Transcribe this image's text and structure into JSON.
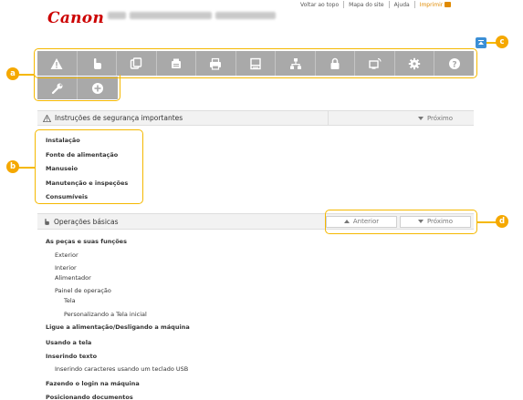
{
  "header": {
    "logo": "Canon",
    "nav": [
      {
        "label": "Voltar ao topo"
      },
      {
        "label": "Mapa do site"
      },
      {
        "label": "Ajuda"
      },
      {
        "label": "Imprimir"
      }
    ]
  },
  "toolbar": {
    "icons": [
      "warning-icon",
      "hand-icon",
      "document-copy-icon",
      "fax-icon",
      "printer-icon",
      "scanner-icon",
      "network-icon",
      "lock-icon",
      "remote-ui-icon",
      "gear-icon",
      "help-icon",
      "wrench-icon",
      "plus-circle-icon"
    ]
  },
  "safety": {
    "title": "Instruções de segurança importantes",
    "next": "Próximo",
    "links": [
      "Instalação",
      "Fonte de alimentação",
      "Manuseio",
      "Manutenção e inspeções",
      "Consumíveis"
    ]
  },
  "basic": {
    "title": "Operações básicas",
    "prev": "Anterior",
    "next": "Próximo",
    "links": [
      {
        "text": "As peças e suas funções",
        "level": 0
      },
      {
        "text": "Exterior",
        "level": 1
      },
      {
        "text": "Interior",
        "level": 1
      },
      {
        "text": "Alimentador",
        "level": 1
      },
      {
        "text": "Painel de operação",
        "level": 1
      },
      {
        "text": "Tela",
        "level": 2
      },
      {
        "text": "Personalizando a Tela inicial",
        "level": 2
      },
      {
        "text": "Ligue a alimentação/Desligando a máquina",
        "level": 0
      },
      {
        "text": "Usando a tela",
        "level": 0
      },
      {
        "text": "Inserindo texto",
        "level": 0
      },
      {
        "text": "Inserindo caracteres usando um teclado USB",
        "level": 1
      },
      {
        "text": "Fazendo o login na máquina",
        "level": 0
      },
      {
        "text": "Posicionando documentos",
        "level": 0
      }
    ]
  },
  "callouts": {
    "a": "a",
    "b": "b",
    "c": "c",
    "d": "d"
  },
  "colors": {
    "accent": "#f5a800",
    "brand": "#cc0000",
    "toolbar": "#a9a9a9"
  }
}
